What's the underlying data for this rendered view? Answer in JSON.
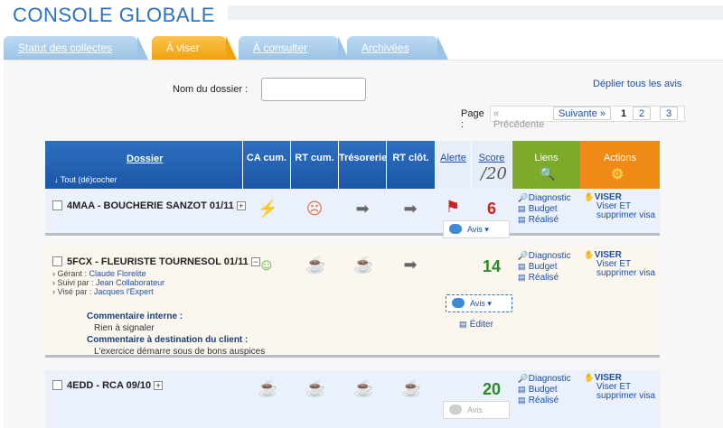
{
  "app": {
    "title": "CONSOLE GLOBALE"
  },
  "tabs": [
    {
      "label": "Statut des collectes"
    },
    {
      "label": "À viser"
    },
    {
      "label": "À consulter"
    },
    {
      "label": "Archivées"
    }
  ],
  "search": {
    "label": "Nom du dossier :",
    "value": ""
  },
  "expand_all": "Déplier tous les avis",
  "pager": {
    "label": "Page :",
    "prev": "« Précédente",
    "next": "Suivante »",
    "pages": [
      "1",
      "2",
      "3"
    ],
    "current": "1"
  },
  "table": {
    "headers": {
      "dossier": "Dossier",
      "toggle_all": "Tout (dé)cocher",
      "ca": "CA cum.",
      "rt": "RT cum.",
      "treso": "Trésorerie",
      "rtclot": "RT clôt.",
      "alerte": "Alerte",
      "score": "Score",
      "score_max": "/20",
      "liens": "Liens",
      "actions": "Actions"
    },
    "rows": [
      {
        "name": "4MAA - BOUCHERIE SANZOT 01/11",
        "indicators": [
          "bolt-icon",
          "sad-face-icon",
          "arrow-right-icon",
          "arrow-right-icon"
        ],
        "alert": "flag-icon",
        "score": "6",
        "links": [
          "Diagnostic",
          "Budget",
          "Réalisé"
        ],
        "actions": {
          "primary": "VISER",
          "secondary": "Viser ET supprimer visa"
        },
        "avis": "Avis"
      },
      {
        "name": "5FCX - FLEURISTE TOURNESOL 01/11",
        "meta": [
          {
            "label": "Gérant :",
            "value": "Claude Florelite"
          },
          {
            "label": "Suivi par :",
            "value": "Jean Collaborateur"
          },
          {
            "label": "Visé par :",
            "value": "Jacques l'Expert"
          }
        ],
        "indicators": [
          "smile-icon",
          "trophy-icon",
          "trophy-icon",
          "arrow-right-icon"
        ],
        "score": "14",
        "links": [
          "Diagnostic",
          "Budget",
          "Réalisé"
        ],
        "actions": {
          "primary": "VISER",
          "secondary": "Viser ET supprimer visa"
        },
        "avis": "Avis",
        "edit": "Éditer",
        "comments": [
          {
            "title": "Commentaire interne :",
            "text": "Rien à signaler"
          },
          {
            "title": "Commentaire à destination du client :",
            "text": "L'exercice démarre sous de bons auspices"
          }
        ]
      },
      {
        "name": "4EDD - RCA 09/10",
        "indicators": [
          "trophy-icon",
          "trophy-icon",
          "trophy-icon",
          "trophy-icon"
        ],
        "score": "20",
        "links": [
          "Diagnostic",
          "Budget",
          "Réalisé"
        ],
        "actions": {
          "primary": "VISER",
          "secondary": "Viser ET supprimer visa"
        },
        "avis": "Avis"
      }
    ]
  }
}
